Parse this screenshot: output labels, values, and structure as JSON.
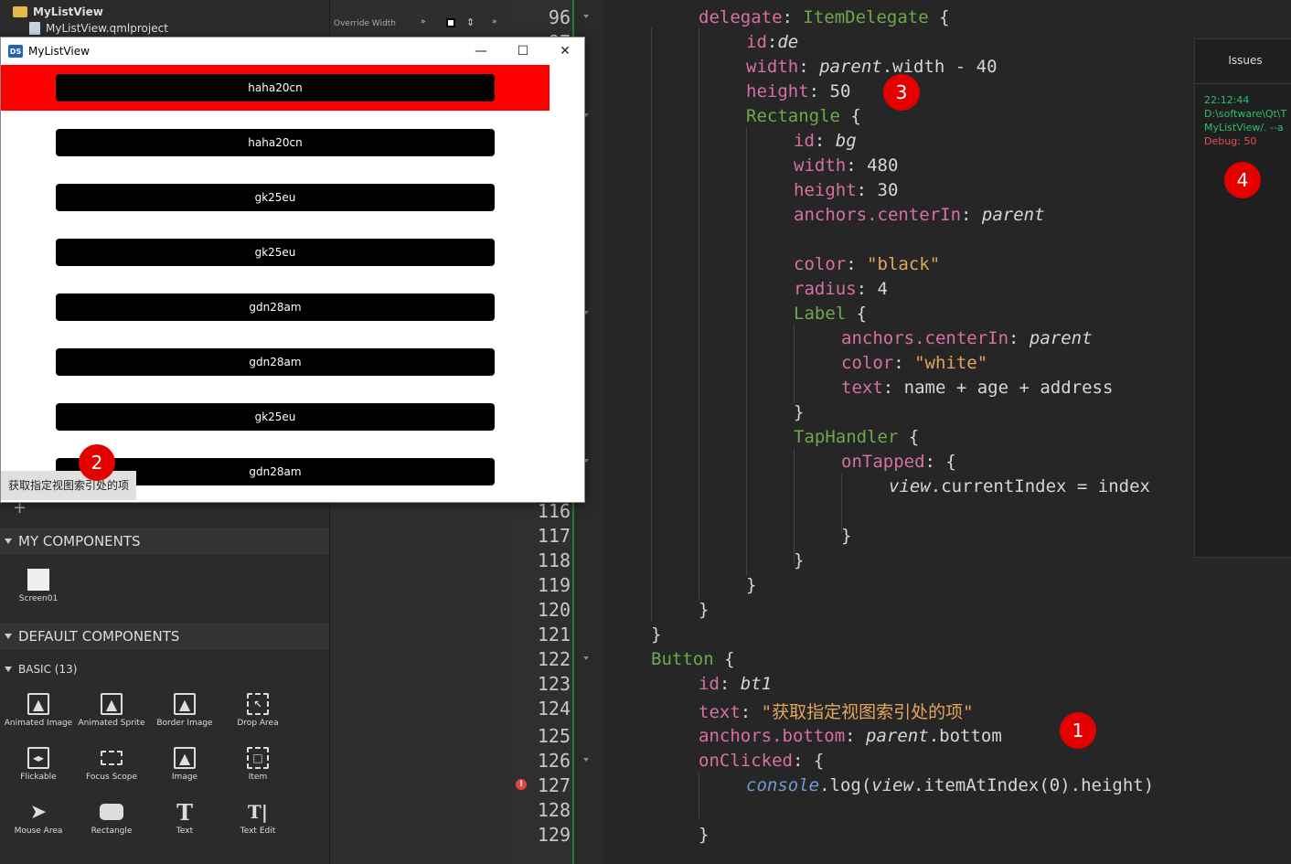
{
  "project_tree": {
    "project_name": "MyListView",
    "project_file": "MyListView.qmlproject",
    "override_label": "Override Width"
  },
  "library": {
    "my_components_header": "MY COMPONENTS",
    "my_components": [
      "Screen01"
    ],
    "default_components_header": "DEFAULT COMPONENTS",
    "basic_header": "BASIC (13)",
    "basic_items": [
      "Animated Image",
      "Animated Sprite",
      "Border Image",
      "Drop Area",
      "Flickable",
      "Focus Scope",
      "Image",
      "Item",
      "Mouse Area",
      "Rectangle",
      "Text",
      "Text Edit"
    ]
  },
  "app_window": {
    "title": "MyListView",
    "logo_text": "DS",
    "minimize_icon": "—",
    "maximize_icon": "☐",
    "close_icon": "✕",
    "items": [
      "haha20cn",
      "haha20cn",
      "gk25eu",
      "gk25eu",
      "gdn28am",
      "gdn28am",
      "gk25eu",
      "gdn28am"
    ],
    "highlight_color": "#ff0000",
    "tooltip": "获取指定视图索引处的项"
  },
  "editor": {
    "line_numbers": [
      "96",
      "97",
      "116",
      "117",
      "118",
      "119",
      "120",
      "121",
      "122",
      "123",
      "124",
      "125",
      "126",
      "127",
      "128",
      "129"
    ],
    "code": {
      "l1_prop": "delegate",
      "l1_type": "ItemDelegate",
      "l1_brace": " {",
      "l2_prop": "id",
      "l2_val": "de",
      "l3_prop": "width",
      "l3_a": "parent",
      "l3_b": ".width - 40",
      "l4_prop": "height",
      "l4_val": "50",
      "l5_type": "Rectangle",
      "l5_brace": " {",
      "l6_prop": "id",
      "l6_val": "bg",
      "l7_prop": "width",
      "l7_val": "480",
      "l8_prop": "height",
      "l8_val": "30",
      "l9_prop": "anchors.centerIn",
      "l9_val": "parent",
      "l10_prop": "color",
      "l10_val": "\"black\"",
      "l11_prop": "radius",
      "l11_val": "4",
      "l12_type": "Label",
      "l12_brace": " {",
      "l13_prop": "anchors.centerIn",
      "l13_val": "parent",
      "l14_prop": "color",
      "l14_val": "\"white\"",
      "l15_prop": "text",
      "l15_val": "name + age + address",
      "l16_brace": "}",
      "l17_type": "TapHandler",
      "l17_brace": " {",
      "l18_prop": "onTapped",
      "l18_brace": " {",
      "l19_a": "view",
      "l19_b": ".currentIndex = index",
      "c116": "}",
      "c117": "}",
      "c118": "}",
      "c119": "}",
      "c120": "}",
      "c121": "}",
      "c122_type": "Button",
      "c122_brace": " {",
      "c123_prop": "id",
      "c123_val": "bt1",
      "c124_prop": "text",
      "c124_val": "\"获取指定视图索引处的项\"",
      "c125_prop": "anchors.bottom",
      "c125_a": "parent",
      "c125_b": ".bottom",
      "c126_prop": "onClicked",
      "c126_brace": " {",
      "c127_a": "console",
      "c127_b": ".log(",
      "c127_c": "view",
      "c127_d": ".itemAtIndex(0).height)",
      "c129": "}"
    }
  },
  "issues_panel": {
    "title": "Issues",
    "time": "22:12:44",
    "path1": "D:\\software\\Qt\\T",
    "path2": "MyListView/. --a",
    "debug": "Debug: 50"
  },
  "badges": [
    "1",
    "2",
    "3",
    "4"
  ],
  "error_icon": "!"
}
